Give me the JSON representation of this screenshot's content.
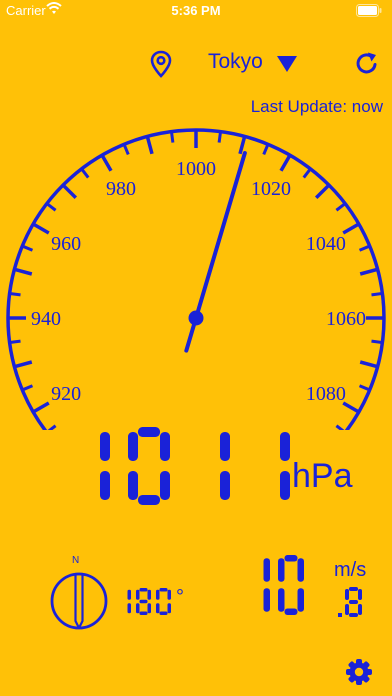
{
  "status_bar": {
    "carrier": "Carrier",
    "time": "5:36 PM"
  },
  "toolbar": {
    "city": "Tokyo"
  },
  "last_update": "Last Update: now",
  "gauge": {
    "labels": [
      "920",
      "940",
      "960",
      "980",
      "1000",
      "1020",
      "1040",
      "1060",
      "1080"
    ],
    "min": 910,
    "max": 1090,
    "needle_value": 1011
  },
  "pressure": {
    "value": "1011",
    "unit": "hPa"
  },
  "wind": {
    "direction_label": "N",
    "direction_value": "180",
    "degree_symbol": "°",
    "speed_integer": "10",
    "speed_fraction": ".8",
    "unit": "m/s"
  },
  "colors": {
    "background": "#FFC107",
    "accent": "#1a22d8",
    "status_text": "#ffffff"
  }
}
